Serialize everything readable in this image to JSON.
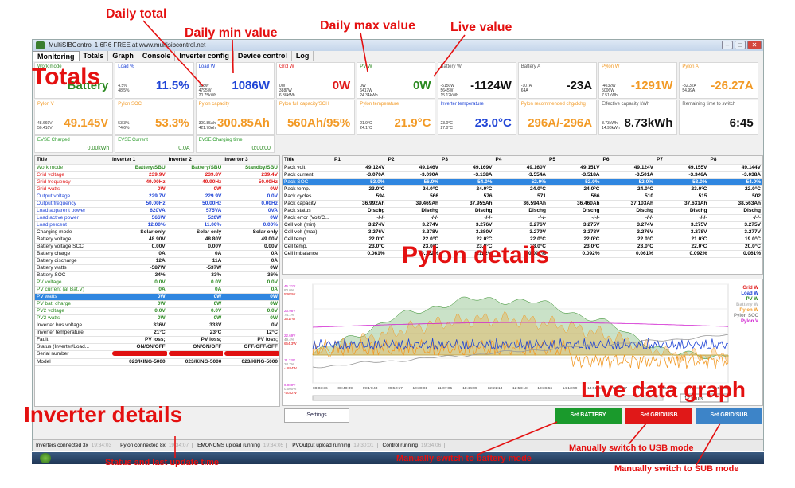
{
  "annotations": {
    "daily_total": "Daily total",
    "daily_min": "Daily min value",
    "daily_max": "Daily max value",
    "live_value": "Live value",
    "totals": "Totals",
    "pylon_details": "Pylon details",
    "inverter_details": "Inverter details",
    "live_graph": "Live data graph",
    "status_time": "Status and last update time",
    "battery_mode": "Manually switch to battery mode",
    "usb_mode": "Manually switch to USB mode",
    "sub_mode": "Manually switch to SUB mode"
  },
  "window": {
    "title": "MultiSIBControl 1.6R6 FREE at www.multisibcontrol.net"
  },
  "tabs": [
    "Monitoring",
    "Totals",
    "Graph",
    "Console",
    "Inverter config",
    "Device control",
    "Log"
  ],
  "tiles_row1": [
    {
      "title": "Work mode",
      "small": "",
      "value": "Battery",
      "color": "#2c8a22"
    },
    {
      "title": "Load %",
      "small": "4.5%\n48.5%",
      "value": "11.5%",
      "color": "#1f44d6"
    },
    {
      "title": "Load W",
      "small": "318W\n4795W\n20.75kWh",
      "value": "1086W",
      "color": "#1f44d6"
    },
    {
      "title": "Grid W",
      "small": "0W\n3887W\n6.38kWh",
      "value": "0W",
      "color": "#e01818"
    },
    {
      "title": "PV W",
      "small": "0W\n6417W\n24.34kWh",
      "value": "0W",
      "color": "#2c8a22"
    },
    {
      "title": "Battery W",
      "small": "-5150W\n5645W\n15.12kWh",
      "value": "-1124W",
      "color": "#111"
    },
    {
      "title": "Battery A",
      "small": "-107A\n64A",
      "value": "-23A",
      "color": "#111"
    },
    {
      "title": "Pylon W",
      "small": "-4032W\n5006W\n7.51kWh",
      "value": "-1291W",
      "color": "#f29a26"
    },
    {
      "title": "Pylon A",
      "small": "-82.32A\n54.99A",
      "value": "-26.27A",
      "color": "#f29a26"
    }
  ],
  "tiles_row2": [
    {
      "title": "Pylon V",
      "small": "48.669V\n50.410V",
      "value": "49.145V",
      "color": "#f29a26"
    },
    {
      "title": "Pylon SOC",
      "small": "53.3%\n74.6%",
      "value": "53.3%",
      "color": "#f29a26"
    },
    {
      "title": "Pylon capacity",
      "small": "300.85Ah\n421.70Ah",
      "value": "300.85Ah",
      "color": "#f29a26"
    },
    {
      "title": "Pylon full capacity/SOH",
      "small": "",
      "value": "560Ah/95%",
      "color": "#f29a26"
    },
    {
      "title": "Pylon temperature",
      "small": "21.9°C\n24.1°C",
      "value": "21.9°C",
      "color": "#f29a26"
    },
    {
      "title": "Inverter temperature",
      "small": "23.0°C\n27.0°C",
      "value": "23.0°C",
      "color": "#1f44d6"
    },
    {
      "title": "Pylon recommended chg/dchg",
      "small": "",
      "value": "296A/-296A",
      "color": "#f29a26"
    },
    {
      "title": "Effective capacity kWh",
      "small": "8.73kWh\n14.98kWh",
      "value": "8.73kWh",
      "color": "#111"
    },
    {
      "title": "Remaining time to switch",
      "small": "",
      "value": "6:45",
      "color": "#111"
    }
  ],
  "evse": [
    {
      "title": "EVSE Charged",
      "value": "0.00kWh"
    },
    {
      "title": "EVSE Current",
      "value": "0.0A"
    },
    {
      "title": "EVSE Charging time",
      "value": "0:00:00"
    }
  ],
  "inverter_table": {
    "headers": [
      "Title",
      "Inverter 1",
      "Inverter 2",
      "Inverter 3"
    ],
    "rows": [
      {
        "label": "Work mode",
        "c": "#2c8a22",
        "vals": [
          "Battery/SBU",
          "Battery/SBU",
          "Standby/SBU"
        ]
      },
      {
        "label": "Grid voltage",
        "c": "#e01818",
        "vals": [
          "239.9V",
          "239.8V",
          "239.4V"
        ]
      },
      {
        "label": "Grid frequency",
        "c": "#e01818",
        "vals": [
          "49.90Hz",
          "49.90Hz",
          "50.00Hz"
        ]
      },
      {
        "label": "Grid watts",
        "c": "#e01818",
        "vals": [
          "0W",
          "0W",
          "0W"
        ]
      },
      {
        "label": "Output voltage",
        "c": "#1f44d6",
        "vals": [
          "229.7V",
          "229.9V",
          "0.0V"
        ]
      },
      {
        "label": "Output frequency",
        "c": "#1f44d6",
        "vals": [
          "50.00Hz",
          "50.00Hz",
          "0.00Hz"
        ]
      },
      {
        "label": "Load apparent power",
        "c": "#1f44d6",
        "vals": [
          "620VA",
          "575VA",
          "0VA"
        ]
      },
      {
        "label": "Load active power",
        "c": "#1f44d6",
        "vals": [
          "566W",
          "520W",
          "0W"
        ]
      },
      {
        "label": "Load percent",
        "c": "#1f44d6",
        "vals": [
          "12.00%",
          "11.00%",
          "0.00%"
        ]
      },
      {
        "label": "Charging mode",
        "c": "#111",
        "vals": [
          "Solar only",
          "Solar only",
          "Solar only"
        ]
      },
      {
        "label": "Battery voltage",
        "c": "#111",
        "vals": [
          "48.90V",
          "48.80V",
          "49.00V"
        ]
      },
      {
        "label": "Battery voltage SCC",
        "c": "#111",
        "vals": [
          "0.00V",
          "0.00V",
          "0.00V"
        ]
      },
      {
        "label": "Battery charge",
        "c": "#111",
        "vals": [
          "0A",
          "0A",
          "0A"
        ]
      },
      {
        "label": "Battery discharge",
        "c": "#111",
        "vals": [
          "12A",
          "11A",
          "0A"
        ]
      },
      {
        "label": "Battery watts",
        "c": "#111",
        "vals": [
          "-587W",
          "-537W",
          "0W"
        ]
      },
      {
        "label": "Battery SOC",
        "c": "#111",
        "vals": [
          "34%",
          "33%",
          "36%"
        ]
      },
      {
        "label": "PV voltage",
        "c": "#2c8a22",
        "vals": [
          "0.0V",
          "0.0V",
          "0.0V"
        ]
      },
      {
        "label": "PV current (at Bat.V)",
        "c": "#2c8a22",
        "vals": [
          "0A",
          "0A",
          "0A"
        ]
      },
      {
        "label": "PV watts",
        "c": "#2c8a22",
        "vals": [
          "0W",
          "0W",
          "0W"
        ],
        "sel": true
      },
      {
        "label": "PV bat. charge",
        "c": "#2c8a22",
        "vals": [
          "0W",
          "0W",
          "0W"
        ]
      },
      {
        "label": "PV2 voltage",
        "c": "#2c8a22",
        "vals": [
          "0.0V",
          "0.0V",
          "0.0V"
        ]
      },
      {
        "label": "PV2 watts",
        "c": "#2c8a22",
        "vals": [
          "0W",
          "0W",
          "0W"
        ]
      },
      {
        "label": "Inverter bus voltage",
        "c": "#111",
        "vals": [
          "336V",
          "333V",
          "0V"
        ]
      },
      {
        "label": "Inverter temperature",
        "c": "#111",
        "vals": [
          "21°C",
          "23°C",
          "12°C"
        ]
      },
      {
        "label": "Fault",
        "c": "#111",
        "vals": [
          "PV loss;",
          "PV loss;",
          "PV loss;"
        ]
      },
      {
        "label": "Status (Inverter/Load...",
        "c": "#111",
        "vals": [
          "ON/ON/OFF",
          "ON/ON/OFF",
          "OFF/OFF/OFF"
        ]
      },
      {
        "label": "Serial number",
        "c": "#111",
        "vals": [
          "",
          "",
          ""
        ],
        "redact": true
      },
      {
        "label": "Model",
        "c": "#111",
        "vals": [
          "023/KING-5000",
          "023/KING-5000",
          "023/KING-5000"
        ]
      }
    ]
  },
  "pylon_table": {
    "headers": [
      "Title",
      "P1",
      "P2",
      "P3",
      "P4",
      "P5",
      "P6",
      "P7",
      "P8"
    ],
    "rows": [
      {
        "label": "Pack volt",
        "vals": [
          "49.124V",
          "49.146V",
          "49.169V",
          "49.160V",
          "49.151V",
          "49.124V",
          "49.155V",
          "49.144V"
        ]
      },
      {
        "label": "Pack current",
        "vals": [
          "-3.070A",
          "-3.090A",
          "-3.138A",
          "-3.554A",
          "-3.518A",
          "-3.501A",
          "-3.346A",
          "-3.038A"
        ]
      },
      {
        "label": "Pack SOC",
        "vals": [
          "53.0%",
          "56.0%",
          "54.0%",
          "52.0%",
          "52.0%",
          "52.0%",
          "53.0%",
          "54.0%"
        ],
        "sel": true
      },
      {
        "label": "Pack temp.",
        "vals": [
          "23.0°C",
          "24.0°C",
          "24.0°C",
          "24.0°C",
          "24.0°C",
          "24.0°C",
          "23.0°C",
          "22.0°C"
        ]
      },
      {
        "label": "Pack cycles",
        "vals": [
          "594",
          "566",
          "576",
          "571",
          "566",
          "510",
          "515",
          "502"
        ]
      },
      {
        "label": "Pack capacity",
        "vals": [
          "36.992Ah",
          "39.469Ah",
          "37.955Ah",
          "36.594Ah",
          "36.460Ah",
          "37.103Ah",
          "37.631Ah",
          "38.563Ah"
        ]
      },
      {
        "label": "Pack status",
        "vals": [
          "Dischg",
          "Dischg",
          "Dischg",
          "Dischg",
          "Dischg",
          "Dischg",
          "Dischg",
          "Dischg"
        ]
      },
      {
        "label": "Pack error (Volt/C...",
        "vals": [
          "-/-/-",
          "-/-/-",
          "-/-/-",
          "-/-/-",
          "-/-/-",
          "-/-/-",
          "-/-/-",
          "-/-/-"
        ]
      },
      {
        "label": "Cell volt (min)",
        "vals": [
          "3.274V",
          "3.274V",
          "3.276V",
          "3.276V",
          "3.275V",
          "3.274V",
          "3.275V",
          "3.275V"
        ]
      },
      {
        "label": "Cell volt (max)",
        "vals": [
          "3.276V",
          "3.278V",
          "3.280V",
          "3.279V",
          "3.278V",
          "3.276V",
          "3.278V",
          "3.277V"
        ]
      },
      {
        "label": "Cell temp.",
        "vals": [
          "22.0°C",
          "22.0°C",
          "22.0°C",
          "22.0°C",
          "22.0°C",
          "22.0°C",
          "21.0°C",
          "19.0°C"
        ]
      },
      {
        "label": "Cell temp.",
        "vals": [
          "23.0°C",
          "23.0°C",
          "23.0°C",
          "23.0°C",
          "23.0°C",
          "23.0°C",
          "22.0°C",
          "20.0°C"
        ]
      },
      {
        "label": "Cell imbalance",
        "vals": [
          "0.061%",
          "0.122%",
          "0.122%",
          "0.091%",
          "0.092%",
          "0.061%",
          "0.092%",
          "0.061%"
        ]
      }
    ]
  },
  "graph": {
    "legend": [
      {
        "name": "Grid W",
        "color": "#e01818"
      },
      {
        "name": "Load W",
        "color": "#1f44d6"
      },
      {
        "name": "PV W",
        "color": "#2c8a22"
      },
      {
        "name": "Battery W",
        "color": "#bbbbbb"
      },
      {
        "name": "Pylon W",
        "color": "#f29a26"
      },
      {
        "name": "Pylon SOC",
        "color": "#888888"
      },
      {
        "name": "Pylon V",
        "color": "#d020d0"
      }
    ],
    "y_labels": [
      [
        "45.21V",
        "80.0%",
        "5362W"
      ],
      [
        "23.98V",
        "74.1%",
        "3617W"
      ],
      [
        "22.69V",
        "49.4%",
        "664.3W"
      ],
      [
        "11.33V",
        "24.7%",
        "-1884W"
      ],
      [
        "0.000V",
        "0.000%",
        "-4032W"
      ]
    ],
    "x_labels": [
      "08:03:36",
      "08:40:39",
      "09:17:43",
      "09:52:57",
      "10:30:01",
      "11:07:05",
      "11:44:09",
      "12:21:13",
      "12:58:18",
      "13:36:56",
      "14:13:59",
      "14:51:03",
      "15:28:07",
      "16:05:11",
      "16:42:15",
      "17:19:19",
      "17:56:23"
    ],
    "range": "12 hours"
  },
  "settings_label": "Settings",
  "buttons": {
    "battery": "Set BATTERY",
    "usb": "Set GRID/USB",
    "sub": "Set GRID/SUB"
  },
  "status": [
    {
      "text": "Inverters connected 3x",
      "time": "19:34:03"
    },
    {
      "text": "Pylon connected 8x",
      "time": "19:34:07"
    },
    {
      "text": "EMONCMS upload running",
      "time": "19:34:05"
    },
    {
      "text": "PVOutput upload running",
      "time": "19:30:01"
    },
    {
      "text": "Control running",
      "time": "19:34:06"
    }
  ]
}
